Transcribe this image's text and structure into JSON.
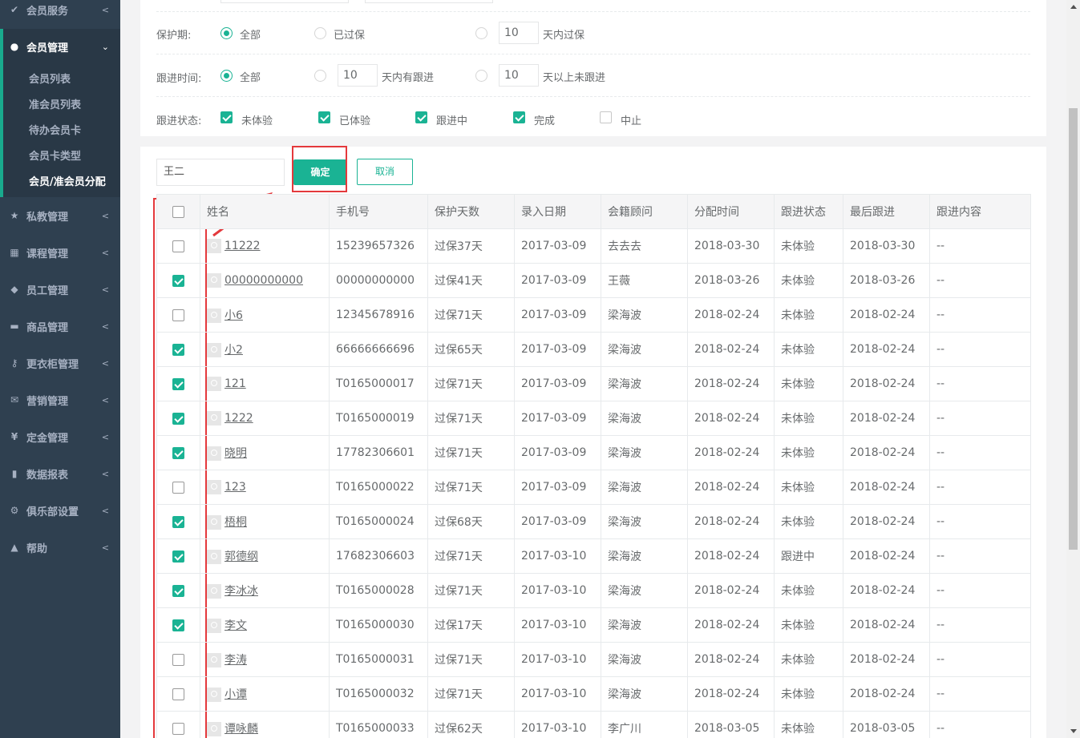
{
  "sidebar": {
    "items": [
      {
        "label": "会员服务",
        "icon": "check-icon"
      },
      {
        "label": "会员管理",
        "icon": "user-icon"
      },
      {
        "label": "私教管理",
        "icon": "star-icon"
      },
      {
        "label": "课程管理",
        "icon": "calendar-icon"
      },
      {
        "label": "员工管理",
        "icon": "users-icon"
      },
      {
        "label": "商品管理",
        "icon": "cart-icon"
      },
      {
        "label": "更衣柜管理",
        "icon": "key-icon"
      },
      {
        "label": "营销管理",
        "icon": "envelope-icon"
      },
      {
        "label": "定金管理",
        "icon": "yen-icon"
      },
      {
        "label": "数据报表",
        "icon": "bar-chart-icon"
      },
      {
        "label": "俱乐部设置",
        "icon": "cog-icon"
      },
      {
        "label": "帮助",
        "icon": "graduation-cap-icon"
      }
    ],
    "sub_items": [
      "会员列表",
      "准会员列表",
      "待办会员卡",
      "会员卡类型",
      "会员/准会员分配"
    ]
  },
  "filters": {
    "protection": {
      "label": "保护期:",
      "all": "全部",
      "expired": "已过保",
      "days_value": "10",
      "within_label": "天内过保"
    },
    "followup_time": {
      "label": "跟进时间:",
      "all": "全部",
      "days_value_1": "10",
      "within_label": "天内有跟进",
      "days_value_2": "10",
      "over_label": "天以上未跟进"
    },
    "followup_status": {
      "label": "跟进状态:",
      "options": [
        {
          "label": "未体验",
          "checked": true
        },
        {
          "label": "已体验",
          "checked": true
        },
        {
          "label": "跟进中",
          "checked": true
        },
        {
          "label": "完成",
          "checked": true
        },
        {
          "label": "中止",
          "checked": false
        }
      ]
    }
  },
  "assign": {
    "search_value": "王二",
    "confirm_label": "确定",
    "cancel_label": "取消"
  },
  "table": {
    "headers": [
      "姓名",
      "手机号",
      "保护天数",
      "录入日期",
      "会籍顾问",
      "分配时间",
      "跟进状态",
      "最后跟进",
      "跟进内容"
    ],
    "rows": [
      {
        "checked": false,
        "name": "11222",
        "phone": "15239657326",
        "protect": "过保37天",
        "date": "2017-03-09",
        "advisor": "去去去",
        "assigned": "2018-03-30",
        "status": "未体验",
        "last": "2018-03-30",
        "content": "--"
      },
      {
        "checked": true,
        "name": "00000000000",
        "phone": "00000000000",
        "protect": "过保41天",
        "date": "2017-03-09",
        "advisor": "王薇",
        "assigned": "2018-03-26",
        "status": "未体验",
        "last": "2018-03-26",
        "content": "--"
      },
      {
        "checked": false,
        "name": "小6",
        "phone": "12345678916",
        "protect": "过保71天",
        "date": "2017-03-09",
        "advisor": "梁海波",
        "assigned": "2018-02-24",
        "status": "未体验",
        "last": "2018-02-24",
        "content": "--"
      },
      {
        "checked": true,
        "name": "小2",
        "phone": "66666666696",
        "protect": "过保65天",
        "date": "2017-03-09",
        "advisor": "梁海波",
        "assigned": "2018-02-24",
        "status": "未体验",
        "last": "2018-02-24",
        "content": "--"
      },
      {
        "checked": true,
        "name": "121",
        "phone": "T0165000017",
        "protect": "过保71天",
        "date": "2017-03-09",
        "advisor": "梁海波",
        "assigned": "2018-02-24",
        "status": "未体验",
        "last": "2018-02-24",
        "content": "--"
      },
      {
        "checked": true,
        "name": "1222",
        "phone": "T0165000019",
        "protect": "过保71天",
        "date": "2017-03-09",
        "advisor": "梁海波",
        "assigned": "2018-02-24",
        "status": "未体验",
        "last": "2018-02-24",
        "content": "--"
      },
      {
        "checked": true,
        "name": "晓明",
        "phone": "17782306601",
        "protect": "过保71天",
        "date": "2017-03-09",
        "advisor": "梁海波",
        "assigned": "2018-02-24",
        "status": "未体验",
        "last": "2018-02-24",
        "content": "--"
      },
      {
        "checked": false,
        "name": "123",
        "phone": "T0165000022",
        "protect": "过保71天",
        "date": "2017-03-09",
        "advisor": "梁海波",
        "assigned": "2018-02-24",
        "status": "未体验",
        "last": "2018-02-24",
        "content": "--"
      },
      {
        "checked": true,
        "name": "梧桐",
        "phone": "T0165000024",
        "protect": "过保68天",
        "date": "2017-03-09",
        "advisor": "梁海波",
        "assigned": "2018-02-24",
        "status": "未体验",
        "last": "2018-02-24",
        "content": "--"
      },
      {
        "checked": true,
        "name": "郭德纲",
        "phone": "17682306603",
        "protect": "过保71天",
        "date": "2017-03-10",
        "advisor": "梁海波",
        "assigned": "2018-02-24",
        "status": "跟进中",
        "last": "2018-02-24",
        "content": "--"
      },
      {
        "checked": true,
        "name": "李冰冰",
        "phone": "T0165000028",
        "protect": "过保71天",
        "date": "2017-03-10",
        "advisor": "梁海波",
        "assigned": "2018-02-24",
        "status": "未体验",
        "last": "2018-02-24",
        "content": "--"
      },
      {
        "checked": true,
        "name": "李文",
        "phone": "T0165000030",
        "protect": "过保17天",
        "date": "2017-03-10",
        "advisor": "梁海波",
        "assigned": "2018-02-24",
        "status": "未体验",
        "last": "2018-02-24",
        "content": "--"
      },
      {
        "checked": false,
        "name": "李涛",
        "phone": "T0165000031",
        "protect": "过保71天",
        "date": "2017-03-10",
        "advisor": "梁海波",
        "assigned": "2018-02-24",
        "status": "未体验",
        "last": "2018-02-24",
        "content": "--"
      },
      {
        "checked": false,
        "name": "小谭",
        "phone": "T0165000032",
        "protect": "过保71天",
        "date": "2017-03-10",
        "advisor": "梁海波",
        "assigned": "2018-02-24",
        "status": "未体验",
        "last": "2018-02-24",
        "content": "--"
      },
      {
        "checked": false,
        "name": "谭咏麟",
        "phone": "T0165000033",
        "protect": "过保62天",
        "date": "2017-03-10",
        "advisor": "李广川",
        "assigned": "2018-03-05",
        "status": "未体验",
        "last": "2018-03-05",
        "content": "--"
      }
    ]
  },
  "colors": {
    "accent": "#1ab394",
    "sidebar": "#2f4050",
    "warn": "#ed5565",
    "highlight": "#e4393c"
  }
}
